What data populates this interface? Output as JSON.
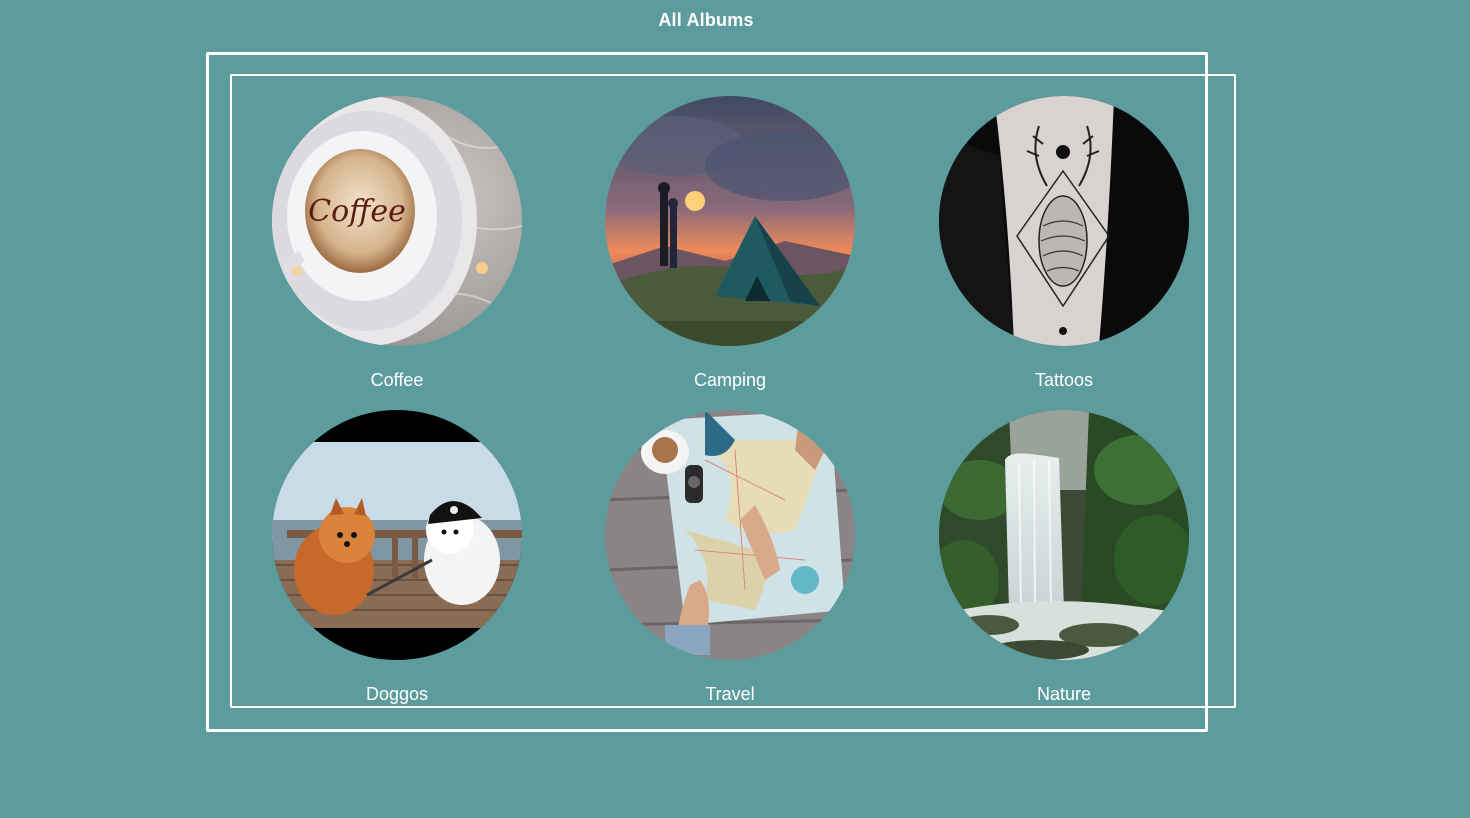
{
  "header": {
    "title": "All Albums"
  },
  "albums": [
    {
      "label": "Coffee",
      "image": "coffee-cup-latte-art-image"
    },
    {
      "label": "Camping",
      "image": "camping-tent-sunset-image"
    },
    {
      "label": "Tattoos",
      "image": "arm-tattoo-shell-antlers-image"
    },
    {
      "label": "Doggos",
      "image": "pomeranian-dogs-pirate-image"
    },
    {
      "label": "Travel",
      "image": "travel-map-hands-image"
    },
    {
      "label": "Nature",
      "image": "jungle-waterfall-image"
    }
  ]
}
